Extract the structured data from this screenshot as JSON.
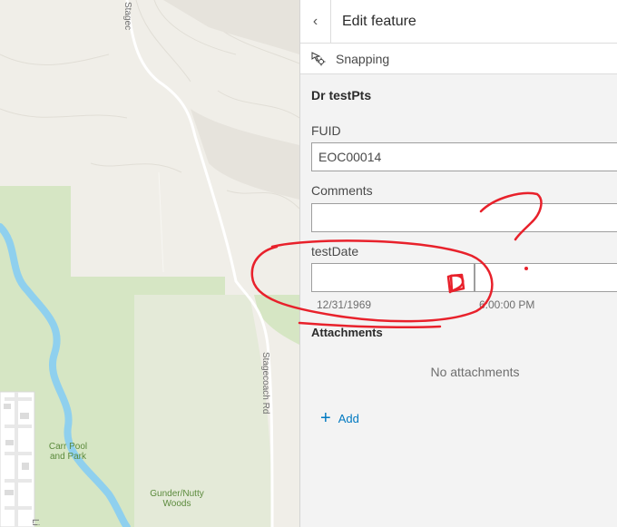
{
  "map": {
    "labels": {
      "road_top": "Stagec",
      "road_right": "Stagecoach Rd",
      "park1": "Carr Pool\nand Park",
      "park2": "Gunder/Nutty\nWoods",
      "partial": "Li"
    },
    "colors": {
      "background": "#f0eee8",
      "park": "#d6e6c4",
      "river": "#8fd0ee",
      "road": "#ffffff"
    }
  },
  "panel": {
    "header": {
      "back_icon": "chevron-left-icon",
      "title": "Edit feature"
    },
    "snapping": {
      "icon": "snapping-icon",
      "label": "Snapping"
    },
    "layer_title": "Dr testPts",
    "fields": {
      "fuid": {
        "label": "FUID",
        "value": "EOC00014"
      },
      "comments": {
        "label": "Comments",
        "value": ""
      },
      "testdate": {
        "label": "testDate",
        "date_hint": "12/31/1969",
        "time_hint": "6:00:00 PM"
      }
    },
    "attachments": {
      "title": "Attachments",
      "empty_text": "No attachments",
      "add_label": "Add",
      "add_icon": "plus-icon"
    }
  },
  "colors": {
    "accent": "#0079c1",
    "annotation": "#e8212b"
  }
}
